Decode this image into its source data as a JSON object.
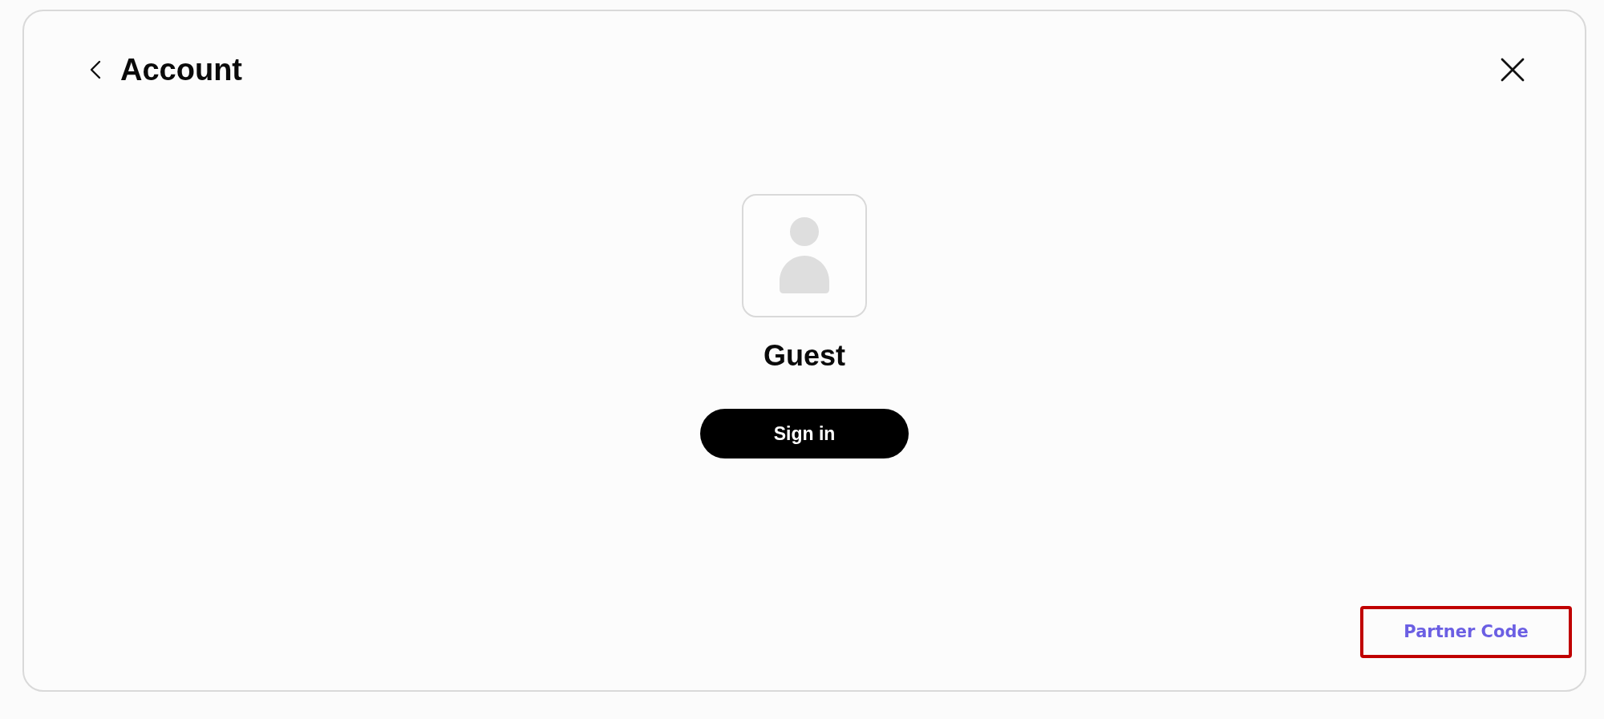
{
  "header": {
    "title": "Account"
  },
  "profile": {
    "name": "Guest",
    "sign_in_button": "Sign in"
  },
  "partner_code": {
    "label": "Partner Code",
    "highlighted": true
  }
}
